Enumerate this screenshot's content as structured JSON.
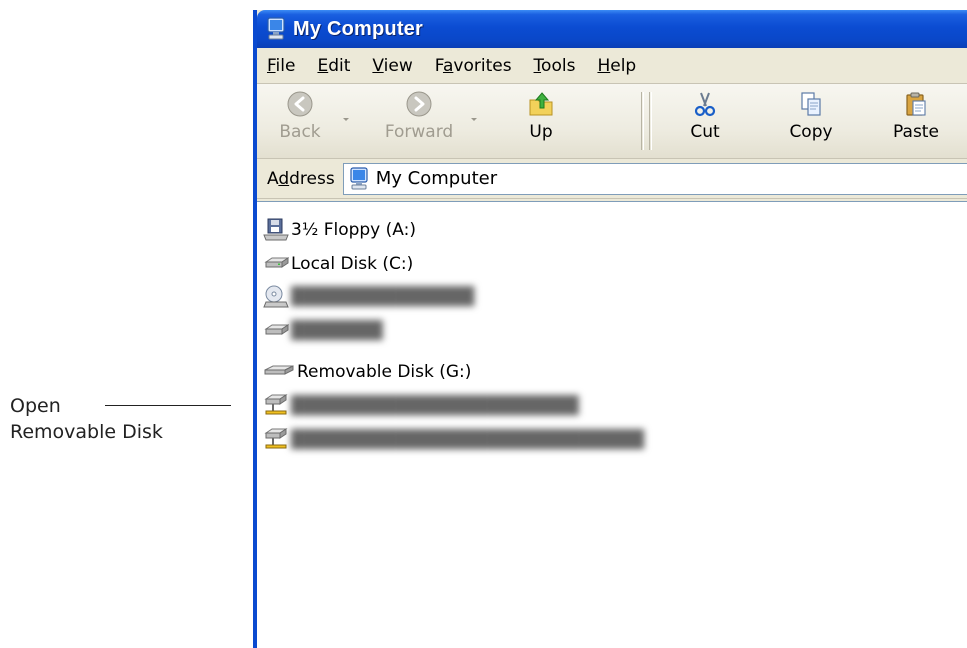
{
  "callout": {
    "line1": "Open",
    "line2": "Removable Disk"
  },
  "window": {
    "title": "My Computer",
    "title_icon": "computer-icon"
  },
  "menu": {
    "items": [
      {
        "label_ul": "F",
        "label_rest": "ile"
      },
      {
        "label_ul": "E",
        "label_rest": "dit"
      },
      {
        "label_ul": "V",
        "label_rest": "iew"
      },
      {
        "label_pre": "F",
        "label_ul": "a",
        "label_rest": "vorites"
      },
      {
        "label_ul": "T",
        "label_rest": "ools"
      },
      {
        "label_ul": "H",
        "label_rest": "elp"
      }
    ]
  },
  "toolbar": {
    "back_label": "Back",
    "forward_label": "Forward",
    "up_label": "Up",
    "cut_label": "Cut",
    "copy_label": "Copy",
    "paste_label": "Paste"
  },
  "address": {
    "label_pre": "A",
    "label_ul": "d",
    "label_rest": "dress",
    "value": "My Computer"
  },
  "drives": [
    {
      "label": "3½ Floppy (A:)",
      "icon": "floppy-drive-icon",
      "blurred": false
    },
    {
      "label": "Local Disk (C:)",
      "icon": "hard-disk-icon",
      "blurred": false
    },
    {
      "label": "",
      "icon": "cd-drive-icon",
      "blurred": true
    },
    {
      "label": "",
      "icon": "hard-disk-icon",
      "blurred": true
    },
    {
      "label": "Removable Disk (G:)",
      "icon": "removable-disk-icon",
      "blurred": false
    },
    {
      "label": "",
      "icon": "network-drive-icon",
      "blurred": true
    },
    {
      "label": "",
      "icon": "network-drive-icon",
      "blurred": true
    }
  ],
  "colors": {
    "titlebar": "#0a47c8",
    "chrome": "#ece9d8",
    "address_border": "#7f9db9"
  }
}
